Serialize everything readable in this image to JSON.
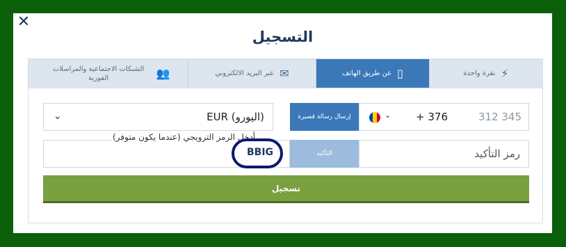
{
  "modal": {
    "title": "التسجيل"
  },
  "tabs": [
    {
      "label": "نقرة واحدة",
      "icon": "lightning-icon"
    },
    {
      "label": "عن طريق الهاتف",
      "icon": "phone-icon"
    },
    {
      "label": "عبر البريد الالكتروني",
      "icon": "envelope-icon"
    },
    {
      "label": "الشبكات الاجتماعية والمراسلات الفورية",
      "icon": "users-icon"
    }
  ],
  "phone": {
    "code": "+ 376",
    "number": "312 345",
    "flag_colors": [
      "#0046ae",
      "#ffd200",
      "#cc092f"
    ]
  },
  "sms_button": "إرسال رسالة قصيرة",
  "currency": {
    "value": "EUR (اليورو)"
  },
  "confirm_button": "التأكيد",
  "code_field": {
    "placeholder": "رمز التأكيد"
  },
  "promo": {
    "label": "أدخل الرمز الترويجي (عندما يكون متوفر)",
    "value": "BBIG"
  },
  "submit_label": "تسجيل",
  "colors": {
    "background": "#0b5f0b",
    "active_tab": "#3a78b8",
    "submit": "#7aa040",
    "circle": "#0b1a6b"
  }
}
